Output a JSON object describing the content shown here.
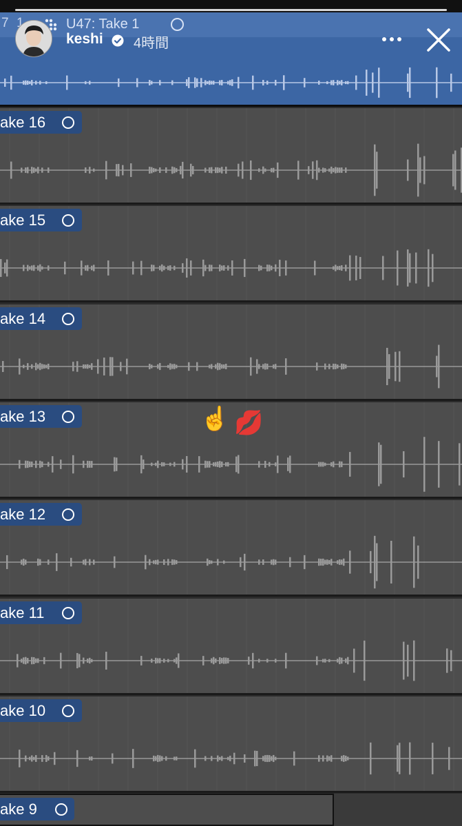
{
  "story": {
    "progress": 1.0,
    "username": "keshi",
    "verified": true,
    "timestamp": "4時間",
    "more_icon": "more-horizontal-icon",
    "close_icon": "close-icon"
  },
  "header_region": {
    "strip_left": "7",
    "strip_num": "1",
    "name": "U47: Take 1",
    "color": "#3c66a4"
  },
  "takes": [
    {
      "label": "ake 16"
    },
    {
      "label": "ake 15"
    },
    {
      "label": "ake 14"
    },
    {
      "label": "ake 13"
    },
    {
      "label": "ake 12"
    },
    {
      "label": "ake 11"
    },
    {
      "label": "ake 10"
    }
  ],
  "last_take": {
    "label": "ake 9"
  },
  "stickers": [
    "☝️",
    "💋"
  ],
  "colors": {
    "region_blue": "#3c66a4",
    "label_blue": "#2a4c80",
    "track_gray": "#4d4d4d",
    "waveform_gray": "#9a9a9a",
    "waveform_light": "#b8c8e6"
  }
}
